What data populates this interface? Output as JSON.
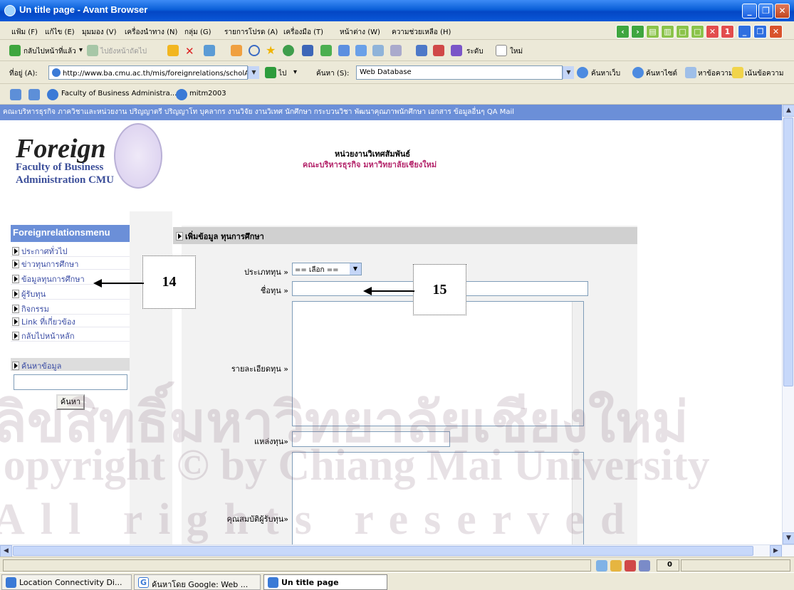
{
  "window": {
    "title": "Un title page - Avant Browser"
  },
  "menu": [
    "แฟ้ม (F)",
    "แก้ไข (E)",
    "มุมมอง (V)",
    "เครื่องนำทาง (N)",
    "กลุ่ม (G)",
    "รายการโปรด (A)",
    "เครื่องมือ (T)",
    "หน้าต่าง (W)",
    "ความช่วยเหลือ (H)"
  ],
  "toolbar": {
    "back": "กลับไปหน้าที่แล้ว",
    "forward": "ไปยังหน้าถัดไป",
    "size": "ระดับ",
    "new": "ใหม่"
  },
  "address": {
    "label": "ที่อยู่ (A):",
    "url": "http://www.ba.cmu.ac.th/mis/foreignrelations/scholAdData.ph",
    "go": "ไป",
    "search_label": "ค้นหา (S):",
    "search_engine": "Web Database",
    "web_search": "ค้นหาเว็บ",
    "site_search": "ค้นหาไซต์",
    "find_text": "หาข้อความ",
    "highlight": "เน้นข้อความ"
  },
  "tabs": [
    "Faculty of Business Administra...",
    "mitm2003"
  ],
  "page": {
    "topnav": "คณะบริหารธุรกิจ  ภาควิชาและหน่วยงาน  ปริญญาตรี  ปริญญาโท  บุคลากร  งานวิจัย  งานวิเทศ  นักศึกษา  กระบวนวิชา  พัฒนาคุณภาพนักศึกษา  เอกสาร  ข้อมูลอื่นๆ  QA  Mail",
    "logo": {
      "title": "Foreign",
      "line2": "Faculty of Business",
      "line3": "Administration CMU"
    },
    "header": {
      "line1": "หน่วยงานวิเทศสัมพันธ์",
      "line2": "คณะบริหารธุรกิจ มหาวิทยาลัยเชียงใหม่"
    },
    "sidemenu": {
      "title": "Foreignrelationsmenu",
      "items": [
        "ประกาศทั่วไป",
        "ข่าวทุนการศึกษา",
        "ข้อมูลทุนการศึกษา",
        "ผู้รับทุน",
        "กิจกรรม",
        "Link ที่เกี่ยวข้อง",
        "กลับไปหน้าหลัก"
      ],
      "search_title": "ค้นหาข้อมูล",
      "search_button": "ค้นหา"
    },
    "form": {
      "heading": "เพิ่มข้อมูล ทุนการศึกษา",
      "type_label": "ประเภททุน »",
      "type_value": "== เลือก ==",
      "name_label": "ชื่อทุน »",
      "detail_label": "รายละเอียดทุน »",
      "source_label": "แหล่งทุน»",
      "qualify_label": "คุณสมบัติผู้รับทุน»"
    },
    "callouts": [
      "14",
      "15"
    ],
    "watermark": [
      "ลิขสิทธิ์มหาวิทยาลัยเชียงใหม่",
      "Copyright © by Chiang Mai University",
      "All rights reserved"
    ]
  },
  "status": {
    "count": "0"
  },
  "taskbar": [
    "Location Connectivity Di...",
    "ค้นหาโดย Google: Web ...",
    "Un title page"
  ]
}
